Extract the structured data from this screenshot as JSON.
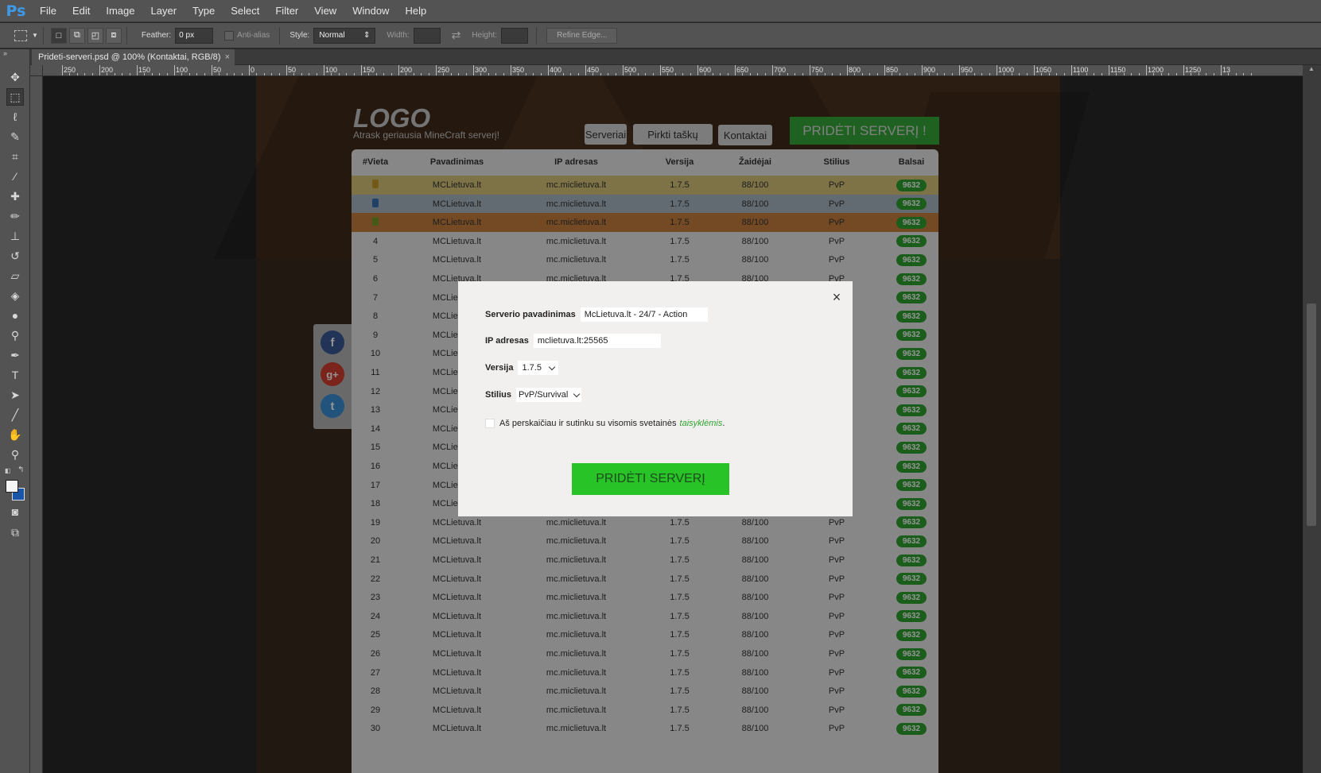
{
  "app": {
    "logo": "Ps"
  },
  "menu": [
    "File",
    "Edit",
    "Image",
    "Layer",
    "Type",
    "Select",
    "Filter",
    "View",
    "Window",
    "Help"
  ],
  "options": {
    "feather_label": "Feather:",
    "feather_value": "0 px",
    "antialias_label": "Anti-alias",
    "style_label": "Style:",
    "style_value": "Normal",
    "width_label": "Width:",
    "height_label": "Height:",
    "refine_label": "Refine Edge..."
  },
  "document_tab": {
    "title": "Prideti-serveri.psd @ 100% (Kontaktai, RGB/8)",
    "close": "×"
  },
  "ruler_labels": [
    "250",
    "200",
    "150",
    "100",
    "50",
    "0",
    "50",
    "100",
    "150",
    "200",
    "250",
    "300",
    "350",
    "400",
    "450",
    "500",
    "550",
    "600",
    "650",
    "700",
    "750",
    "800",
    "850",
    "900",
    "950",
    "1000",
    "1050",
    "1100",
    "1150",
    "1200",
    "1250",
    "13"
  ],
  "site": {
    "logo": "LOGO",
    "tagline": "Atrask geriausia MineCraft serverį!",
    "nav": [
      "Serveriai",
      "Pirkti taškų",
      "Kontaktai"
    ],
    "add_server": "PRIDĖTI SERVERĮ !",
    "table_headers": [
      "#Vieta",
      "Pavadinimas",
      "IP adresas",
      "Versija",
      "Žaidėjai",
      "Stilius",
      "Balsai"
    ],
    "row_template": {
      "name": "MCLietuva.lt",
      "ip": "mc.miclietuva.lt",
      "version": "1.7.5",
      "players": "88/100",
      "style": "PvP",
      "votes": "9632"
    },
    "ranks": [
      "",
      "",
      "",
      "4",
      "5",
      "6",
      "7",
      "8",
      "9",
      "10",
      "11",
      "12",
      "13",
      "14",
      "15",
      "16",
      "17",
      "18",
      "19",
      "20",
      "21",
      "22",
      "23",
      "24",
      "25",
      "26",
      "27",
      "28",
      "29",
      "30"
    ]
  },
  "modal": {
    "server_name_label": "Serverio pavadinimas",
    "server_name_value": "McLietuva.lt - 24/7 - Action",
    "ip_label": "IP adresas",
    "ip_value": "mclietuva.lt:25565",
    "version_label": "Versija",
    "version_value": "1.7.5",
    "style_label": "Stilius",
    "style_value": "PvP/Survival",
    "terms_text": "Aš perskaičiau ir sutinku su visomis svetainės",
    "terms_link": "taisyklėmis",
    "terms_end": ".",
    "submit": "PRIDĖTI SERVERĮ",
    "close": "×"
  },
  "colors": {
    "accent_green": "#2fa331",
    "ps_blue": "#3d9ae8",
    "gold_row": "#d8c779",
    "blue_row": "#a9b8c5",
    "bronze_row": "#c9803f"
  }
}
